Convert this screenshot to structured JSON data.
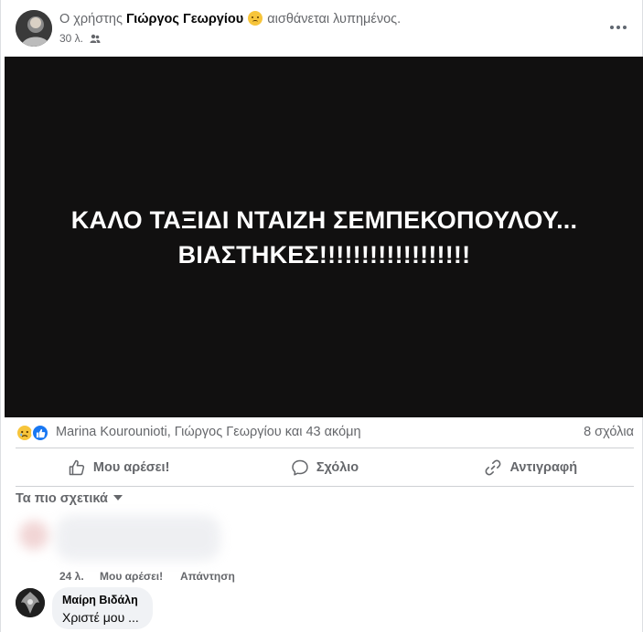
{
  "header": {
    "prefix": "Ο χρήστης",
    "author": "Γιώργος Γεωργίου",
    "feeling": "αισθάνεται λυπημένος.",
    "feeling_icon": "sad-face-emoji",
    "time": "30 λ.",
    "audience_icon": "friends-icon"
  },
  "image": {
    "background": "#111010",
    "line1": "ΚΑΛΟ ΤΑΞΙΔΙ ΝΤΑΙΖΗ ΣΕΜΠΕΚΟΠΟΥΛΟΥ...",
    "line2": "ΒΙΑΣΤΗΚΕΣ!!!!!!!!!!!!!!!!!!"
  },
  "reactions": {
    "icons": [
      "sad-reaction-icon",
      "like-reaction-icon"
    ],
    "text": "Marina Kourounioti, Γιώργος Γεωργίου και 43 ακόμη",
    "comments": "8 σχόλια"
  },
  "actions": {
    "like": "Μου αρέσει!",
    "comment": "Σχόλιο",
    "share": "Αντιγραφή"
  },
  "sort": "Τα πιο σχετικά",
  "comments": [
    {
      "blurred": true,
      "time": "24 λ.",
      "like": "Μου αρέσει!",
      "reply": "Απάντηση"
    },
    {
      "name": "Μαίρη Βιδάλη",
      "text": "Χριστέ μου ..."
    }
  ],
  "colors": {
    "accent": "#1877f2",
    "secondary_text": "#65676b",
    "bubble": "#f0f2f5"
  }
}
